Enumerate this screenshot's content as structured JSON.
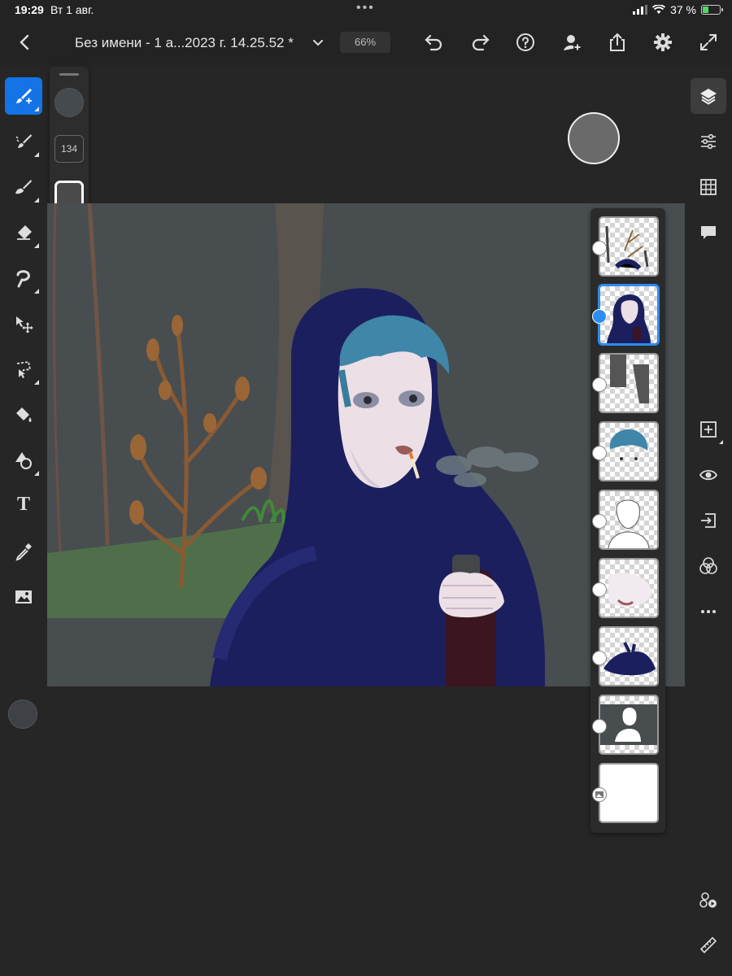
{
  "status_bar": {
    "time": "19:29",
    "date": "Вт 1 авг.",
    "battery_percent": "37 %",
    "battery_level": 0.37,
    "multitask_dots": "•••"
  },
  "top_bar": {
    "document_title": "Без имени - 1 а...2023 г. 14.25.52 *",
    "zoom": "66%",
    "icons": [
      "back-icon",
      "chevron-down-icon",
      "undo-icon",
      "redo-icon",
      "help-icon",
      "invite-icon",
      "share-icon",
      "settings-icon",
      "fullscreen-icon"
    ]
  },
  "left_toolbar": {
    "tools": [
      "paint-brush",
      "brush",
      "smudge",
      "eraser",
      "lasso",
      "move",
      "selection",
      "fill",
      "shape",
      "text",
      "eyedropper",
      "image",
      "color"
    ],
    "text_tool_label": "T",
    "active_tool": "paint-brush"
  },
  "brush_flyout": {
    "brush_size": "134",
    "icons": [
      "color-icon",
      "size-icon",
      "shape-icon",
      "stroke-smoothing-icon",
      "pressure-icon",
      "brush-settings-icon"
    ]
  },
  "canvas": {
    "background_color": "#484d50",
    "description_colors": {
      "hood": "#1c1f5e",
      "hair": "#3f86a8",
      "skin": "#ecdfe6",
      "trunk": "#6a5a50",
      "plant": "#8a5a33",
      "grass": "#4c7a46"
    }
  },
  "layers_panel": {
    "selected_index": 1,
    "layers": [
      {
        "id": "layer-1",
        "type": "pixel"
      },
      {
        "id": "layer-2",
        "type": "pixel"
      },
      {
        "id": "layer-3",
        "type": "pixel"
      },
      {
        "id": "layer-4",
        "type": "pixel"
      },
      {
        "id": "layer-5",
        "type": "pixel"
      },
      {
        "id": "layer-6",
        "type": "pixel"
      },
      {
        "id": "layer-7",
        "type": "pixel"
      },
      {
        "id": "layer-8",
        "type": "pixel"
      },
      {
        "id": "layer-9",
        "type": "image"
      }
    ]
  },
  "right_toolbar": {
    "icons": [
      "layers-icon",
      "adjustments-icon",
      "grid-icon",
      "comments-icon",
      "add-layer-icon",
      "visibility-icon",
      "import-icon",
      "blend-icon",
      "more-icon",
      "livestream-icon",
      "ruler-icon"
    ]
  },
  "colors": {
    "accent": "#1473e6",
    "ui_dark": "#262626"
  }
}
